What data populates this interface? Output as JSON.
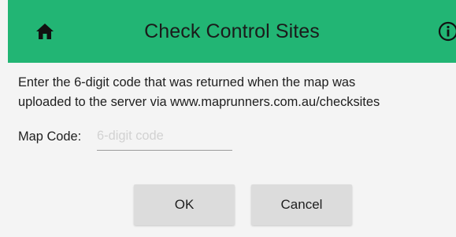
{
  "header": {
    "title": "Check Control Sites",
    "home_icon": "home-icon",
    "info_icon": "info-icon",
    "background_color": "#22b574"
  },
  "instructions": {
    "line1": "Enter the 6-digit code that was returned when the map was",
    "line2": "uploaded to the server via www.maprunners.com.au/checksites"
  },
  "map_code": {
    "label": "Map Code:",
    "value": "",
    "placeholder": "6-digit code"
  },
  "buttons": {
    "ok_label": "OK",
    "cancel_label": "Cancel"
  }
}
